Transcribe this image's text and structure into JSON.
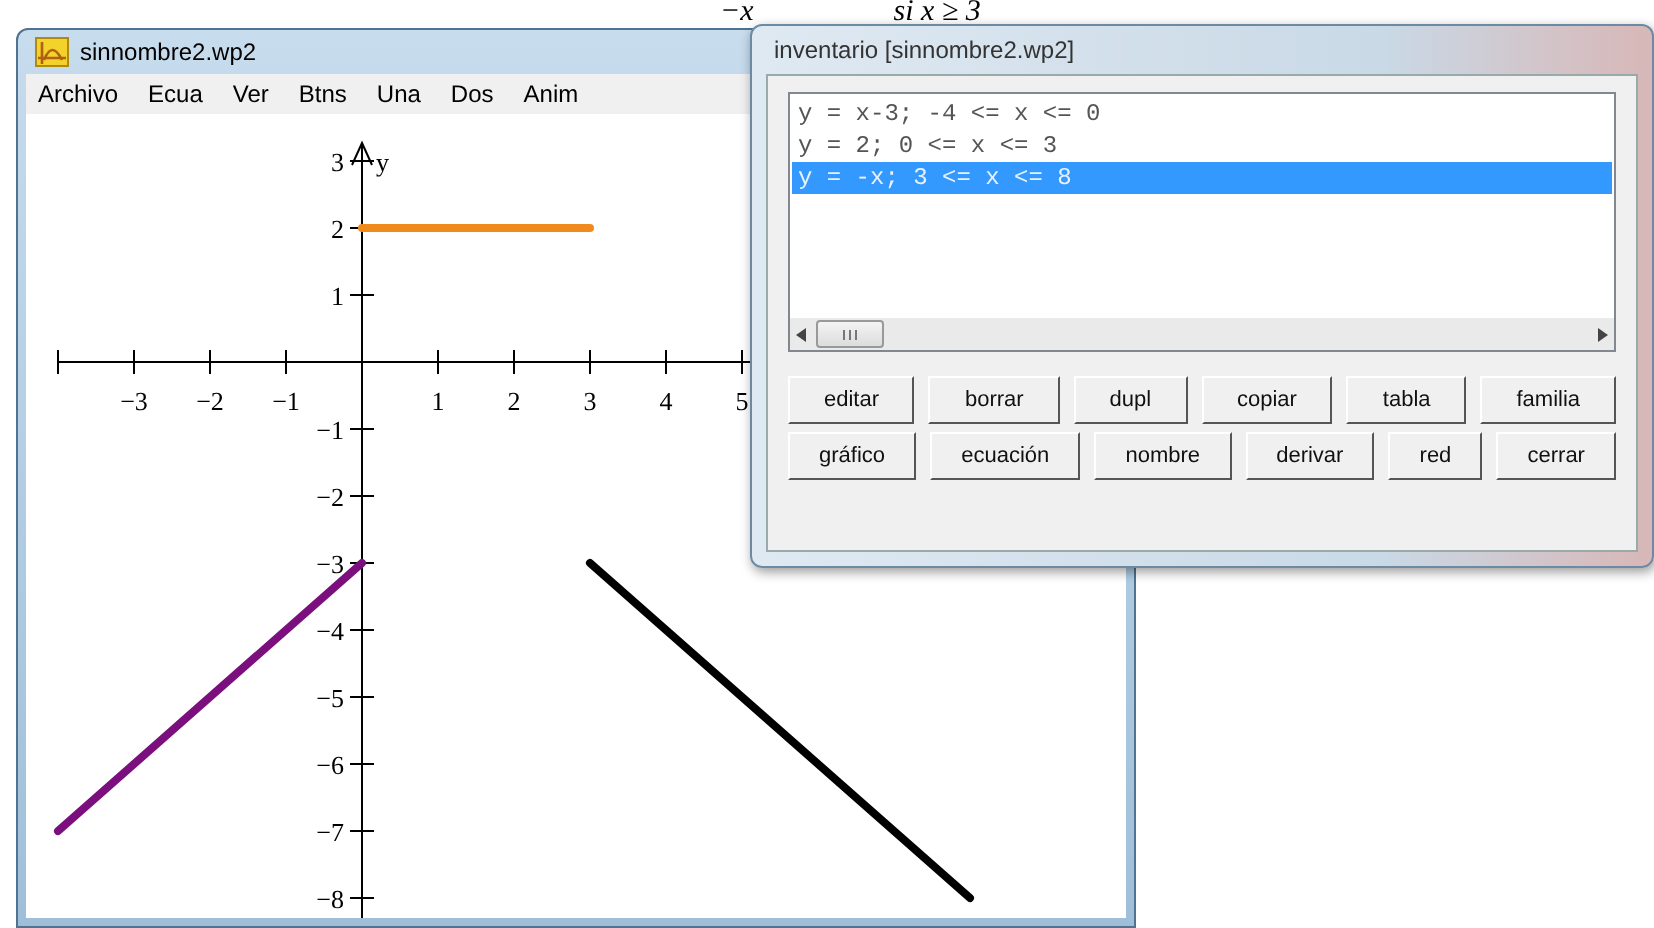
{
  "document_formula": [
    "−x",
    "si x ≥ 3"
  ],
  "graph_window": {
    "title": "sinnombre2.wp2",
    "menu": [
      "Archivo",
      "Ecua",
      "Ver",
      "Btns",
      "Una",
      "Dos",
      "Anim"
    ],
    "chart_data": {
      "type": "line",
      "ylabel": "y",
      "x": [
        -4,
        0,
        3,
        8
      ],
      "xlim": [
        -4,
        8
      ],
      "ylim": [
        -8,
        3
      ],
      "xticks": [
        -3,
        -2,
        -1,
        1,
        2,
        3,
        4,
        5
      ],
      "yticks": [
        -8,
        -7,
        -6,
        -5,
        -4,
        -3,
        -2,
        -1,
        1,
        2,
        3
      ],
      "series": [
        {
          "color": "#7b0f7e",
          "values": [
            -7,
            -3,
            null,
            null
          ]
        },
        {
          "color": "#f08a1c",
          "values": [
            null,
            2,
            2,
            null
          ]
        },
        {
          "color": "#000000",
          "values": [
            null,
            null,
            -3,
            -8
          ]
        }
      ]
    }
  },
  "inventory": {
    "title": "inventario [sinnombre2.wp2]",
    "items": [
      {
        "text": "y = x-3; -4 <= x <= 0",
        "selected": false
      },
      {
        "text": "y = 2; 0 <= x <= 3",
        "selected": false
      },
      {
        "text": "y = -x; 3 <= x <= 8",
        "selected": true
      }
    ],
    "buttons": [
      [
        "editar",
        "borrar",
        "dupl",
        "copiar",
        "tabla",
        "familia"
      ],
      [
        "gráfico",
        "ecuación",
        "nombre",
        "derivar",
        "red",
        "cerrar"
      ]
    ]
  }
}
